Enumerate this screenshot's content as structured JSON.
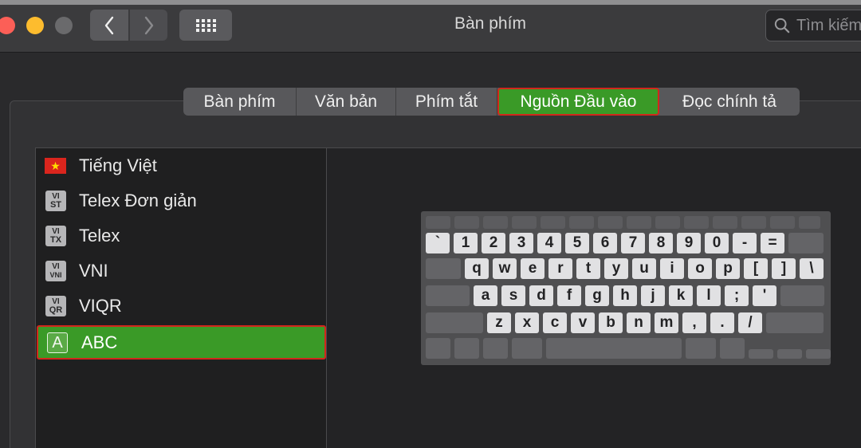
{
  "window": {
    "title": "Bàn phím",
    "search_placeholder": "Tìm kiếm"
  },
  "tabs": [
    {
      "label": "Bàn phím",
      "active": false
    },
    {
      "label": "Văn bản",
      "active": false
    },
    {
      "label": "Phím tắt",
      "active": false
    },
    {
      "label": "Nguồn Đầu vào",
      "active": true
    },
    {
      "label": "Đọc chính tả",
      "active": false
    }
  ],
  "input_sources": [
    {
      "label": "Tiếng Việt",
      "icon": "vietnam-flag-icon",
      "icon_glyph": "★"
    },
    {
      "label": "Telex Đơn giản",
      "icon": "vi-simple-telex-icon",
      "icon_top": "VI",
      "icon_bottom": "ST"
    },
    {
      "label": "Telex",
      "icon": "vi-telex-icon",
      "icon_top": "VI",
      "icon_bottom": "TX"
    },
    {
      "label": "VNI",
      "icon": "vi-vni-icon",
      "icon_top": "VI",
      "icon_bottom": "VNI"
    },
    {
      "label": "VIQR",
      "icon": "vi-viqr-icon",
      "icon_top": "VI",
      "icon_bottom": "QR"
    },
    {
      "label": "ABC",
      "icon": "abc-icon",
      "icon_glyph": "A",
      "selected": true
    }
  ],
  "keyboard": {
    "number_row": [
      "`",
      "1",
      "2",
      "3",
      "4",
      "5",
      "6",
      "7",
      "8",
      "9",
      "0",
      "-",
      "="
    ],
    "top_row": [
      "q",
      "w",
      "e",
      "r",
      "t",
      "y",
      "u",
      "i",
      "o",
      "p",
      "[",
      "]",
      "\\"
    ],
    "home_row": [
      "a",
      "s",
      "d",
      "f",
      "g",
      "h",
      "j",
      "k",
      "l",
      ";",
      "'"
    ],
    "bottom_row": [
      "z",
      "x",
      "c",
      "v",
      "b",
      "n",
      "m",
      ",",
      ".",
      "/"
    ]
  },
  "colors": {
    "accent_green": "#3a9a27",
    "highlight_red": "#d2271c",
    "traffic_red": "#fc5f57",
    "traffic_yellow": "#fdbc2e"
  }
}
